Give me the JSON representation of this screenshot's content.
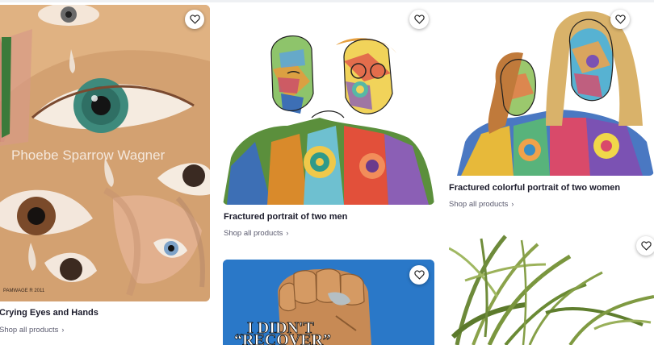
{
  "products": [
    {
      "title": "Crying Eyes and Hands",
      "shop_label": "Shop all products",
      "watermark": "Phoebe Sparrow Wagner",
      "artist_sig": "PAMWAGE R 2011"
    },
    {
      "title": "Fractured portrait of two men",
      "shop_label": "Shop all products"
    },
    {
      "title": "Fractured colorful portrait of two women",
      "shop_label": "Shop all products"
    },
    {
      "poster_text_line1": "I DIDN'T",
      "poster_text_line2": "“RECOVER”"
    },
    {}
  ],
  "icons": {
    "favorite": "heart-outline-icon",
    "chevron": "chevron-right-icon"
  },
  "colors": {
    "title_text": "#1b1b2b",
    "link_text": "#5a5a6e",
    "poster_blue": "#2a78c8"
  }
}
